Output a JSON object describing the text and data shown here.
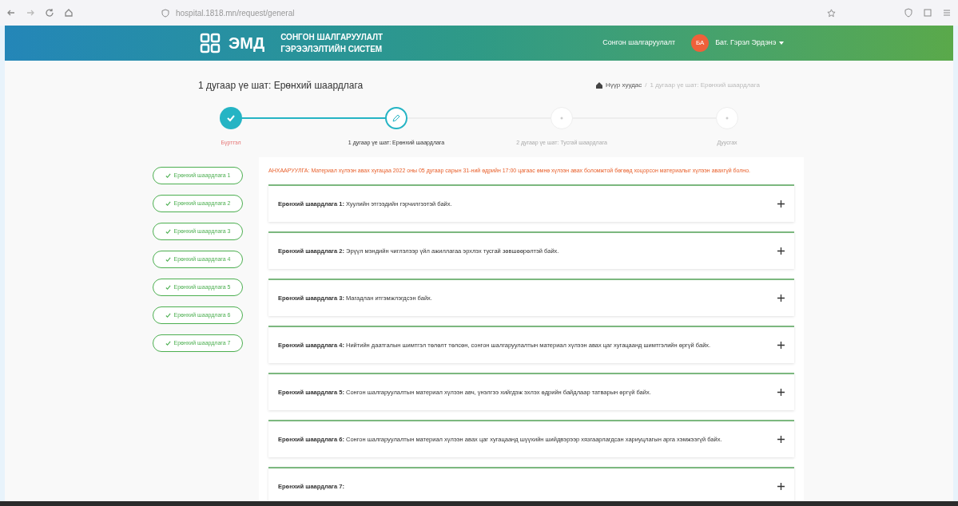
{
  "browser": {
    "url": "hospital.1818.mn/request/general"
  },
  "header": {
    "logo": "ЭМД",
    "system_title_line1": "СОНГОН ШАЛГАРУУЛАЛТ",
    "system_title_line2": "ГЭРЭЭЛЭЛТИЙН СИСТЕМ",
    "nav_link": "Сонгон шалгаруулалт",
    "avatar_initials": "БА",
    "user_name": "Бат. Гэрэл Эрдэнэ"
  },
  "page_title": "1 дугаар үе шат: Ерөнхий шаардлага",
  "breadcrumb": [
    "Нүүр хуудас",
    "1 дугаар үе шат: Ерөнхий шаардлага"
  ],
  "breadcrumb_separator": "/",
  "steps": [
    {
      "label": "Бүртгэл",
      "completed": true,
      "selected": false
    },
    {
      "label": "1 дугаар үе шат: Ерөнхий шаардлага",
      "completed": false,
      "selected": true
    },
    {
      "label": "2 дугаар үе шат: Тусгай шаардлага",
      "completed": false,
      "selected": false
    },
    {
      "label": "Дуусгах",
      "completed": false,
      "selected": false
    }
  ],
  "side_links": [
    {
      "label": "Ерөнхий шаардлага 1"
    },
    {
      "label": "Ерөнхий шаардлага 2"
    },
    {
      "label": "Ерөнхий шаардлага 3"
    },
    {
      "label": "Ерөнхий шаардлага 4"
    },
    {
      "label": "Ерөнхий шаардлага 5"
    },
    {
      "label": "Ерөнхий шаардлага 6"
    },
    {
      "label": "Ерөнхий шаардлага 7"
    }
  ],
  "warning": "АНХААРУУЛГА: Материал хүлээн авах хугацаа 2022 оны 05 дугаар сарын 31-ний өдрийн 17:00 цагаас өмнө хүлээн авах боломжтой бөгөөд хоцорсон материалыг хүлээн авахгүй болно.",
  "requirements": [
    {
      "title": "Ерөнхий шаардлага 1:",
      "text": "Хуулийн этгээдийн гэрчилгээтэй байх.",
      "expanded": false
    },
    {
      "title": "Ерөнхий шаардлага 2:",
      "text": "Эрүүл мэндийн чиглэлээр үйл ажиллагаа эрхлэх тусгай зөвшөөрөлтэй байх.",
      "expanded": false
    },
    {
      "title": "Ерөнхий шаардлага 3:",
      "text": "Магадлан итгэмжлэгдсэн байх.",
      "expanded": false
    },
    {
      "title": "Ерөнхий шаардлага 4:",
      "text": "Нийтийн даатгалын шимтгэл төлөлт төлсөн, сонгон шалгаруулалтын материал хүлээн авах цаг хугацаанд шимтгэлийн өргүй байх.",
      "expanded": false
    },
    {
      "title": "Ерөнхий шаардлага 5:",
      "text": "Сонгон шалгаруулалтын материал хүлээн авч, үнэлгээ хийгдэж эхлэх өдрийн байдлаар татварын өргүй байх.",
      "expanded": false
    },
    {
      "title": "Ерөнхий шаардлага 6:",
      "text": "Сонгон шалгаруулалтын материал хүлээн авах цаг хугацаанд шүүхийн шийдвэрээр хязгаарлагдсан хариуцлагын арга хэмжээгүй байх.",
      "expanded": false
    },
    {
      "title": "Ерөнхий шаардлага 7:",
      "expanded": false
    }
  ]
}
